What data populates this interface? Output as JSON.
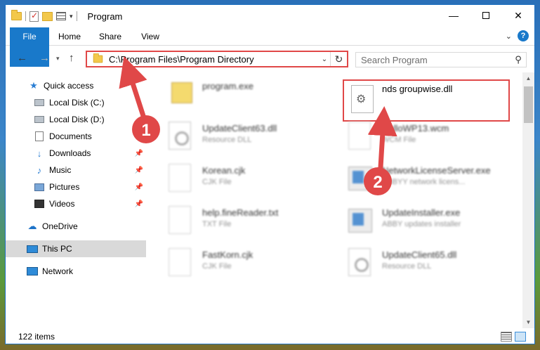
{
  "window": {
    "title": "Program",
    "minimize_glyph": "—",
    "close_glyph": "✕"
  },
  "ribbon": {
    "tabs": [
      {
        "label": "File"
      },
      {
        "label": "Home"
      },
      {
        "label": "Share"
      },
      {
        "label": "View"
      }
    ],
    "help_glyph": "?"
  },
  "nav": {
    "address": "C:\\Program Files\\Program Directory",
    "search_placeholder": "Search Program"
  },
  "sidebar": {
    "items": [
      {
        "label": "Quick access",
        "icon": "star-icon"
      },
      {
        "label": "Local Disk (C:)",
        "icon": "disk-icon"
      },
      {
        "label": "Local Disk (D:)",
        "icon": "disk-icon"
      },
      {
        "label": "Documents",
        "icon": "documents-icon"
      },
      {
        "label": "Downloads",
        "icon": "download-icon",
        "pinned": true
      },
      {
        "label": "Music",
        "icon": "music-icon",
        "pinned": true
      },
      {
        "label": "Pictures",
        "icon": "pictures-icon",
        "pinned": true
      },
      {
        "label": "Videos",
        "icon": "videos-icon",
        "pinned": true
      },
      {
        "label": "OneDrive",
        "icon": "cloud-icon"
      },
      {
        "label": "This PC",
        "icon": "pc-icon",
        "selected": true
      },
      {
        "label": "Network",
        "icon": "network-icon"
      }
    ]
  },
  "files": [
    {
      "name": "program.exe",
      "type": ""
    },
    {
      "name": "nds groupwise.dll",
      "type": "",
      "highlighted": true
    },
    {
      "name": "UpdateClient63.dll",
      "type": "Resource DLL"
    },
    {
      "name": "HelloWP13.wcm",
      "type": "WCM File"
    },
    {
      "name": "Korean.cjk",
      "type": "CJK File"
    },
    {
      "name": "NetworkLicenseServer.exe",
      "type": "ABBYY network licens..."
    },
    {
      "name": "help.fineReader.txt",
      "type": "TXT File"
    },
    {
      "name": "UpdateInstaller.exe",
      "type": "ABBY updates installer"
    },
    {
      "name": "FastKorn.cjk",
      "type": "CJK File"
    },
    {
      "name": "UpdateClient65.dll",
      "type": "Resource DLL"
    }
  ],
  "status": {
    "item_count": "122 items"
  },
  "annotations": {
    "badge_1": "1",
    "badge_2": "2",
    "color": "#e04848"
  }
}
